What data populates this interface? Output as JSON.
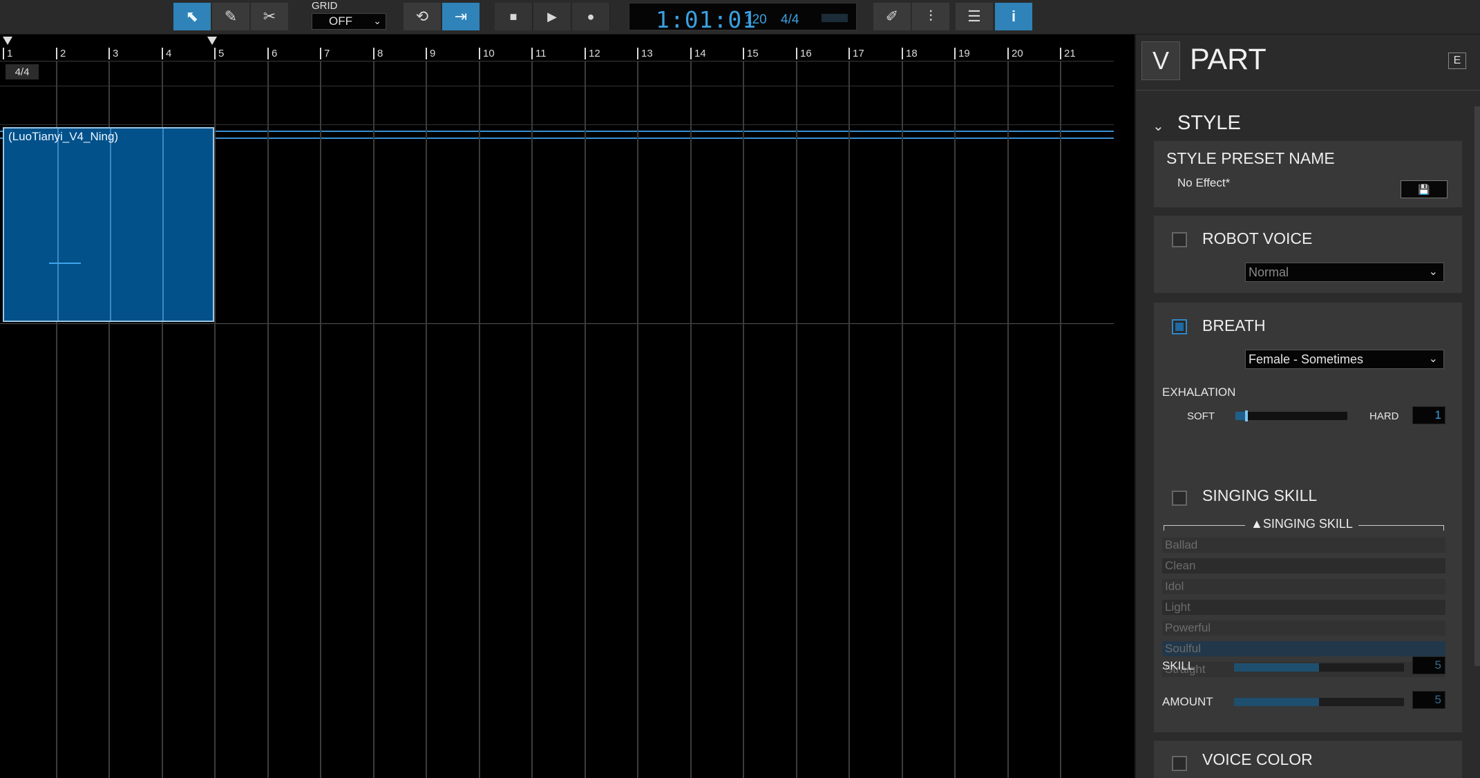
{
  "toolbar": {
    "tools": [
      {
        "name": "select-tool",
        "icon": "arrow-pointer-icon",
        "glyph": "⬉",
        "active": true
      },
      {
        "name": "pencil-tool",
        "icon": "pencil-icon",
        "glyph": "✎",
        "active": false
      },
      {
        "name": "scissors-tool",
        "icon": "scissors-icon",
        "glyph": "✂",
        "active": false
      }
    ],
    "grid_label": "GRID",
    "grid_value": "OFF",
    "loop_glyph": "⟲",
    "autoscroll_glyph": "⇥",
    "transport": {
      "stop_glyph": "■",
      "play_glyph": "▶",
      "record_glyph": "●"
    },
    "display": {
      "time": "1:01:01",
      "tempo": "120",
      "time_signature": "4/4"
    },
    "right_tools": [
      {
        "name": "edit-panel-button",
        "icon": "edit-icon",
        "glyph": "✐",
        "active": false
      },
      {
        "name": "mixer-button",
        "icon": "mixer-icon",
        "glyph": "⫶",
        "active": false
      },
      {
        "name": "list-button",
        "icon": "list-icon",
        "glyph": "☰",
        "active": false
      },
      {
        "name": "inspector-button",
        "icon": "info-icon",
        "glyph": "i",
        "active": true
      }
    ]
  },
  "arranger": {
    "bars": [
      "1",
      "2",
      "3",
      "4",
      "5",
      "6",
      "7",
      "8",
      "9",
      "10",
      "11",
      "12",
      "13",
      "14",
      "15",
      "16",
      "17",
      "18",
      "19",
      "20",
      "21"
    ],
    "time_signature": "4/4",
    "part": {
      "label": "(LuoTianyi_V4_Ning)"
    },
    "colors": {
      "part_fill": "#02518a",
      "accent": "#3aa0e0"
    }
  },
  "panel": {
    "logo": "V",
    "title": "PART",
    "menu_icon": "E",
    "section_title": "STYLE",
    "style_preset": {
      "label": "STYLE PRESET NAME",
      "value": "No Effect*"
    },
    "robot_voice": {
      "label": "ROBOT VOICE",
      "checked": false,
      "value": "Normal"
    },
    "breath": {
      "label": "BREATH",
      "checked": true,
      "value": "Female - Sometimes",
      "exhalation_label": "EXHALATION",
      "soft_label": "SOFT",
      "hard_label": "HARD",
      "exhalation_value": "1",
      "exhalation_level": 0.1
    },
    "singing_skill": {
      "label": "SINGING SKILL",
      "checked": false,
      "group_label": "SINGING SKILL",
      "items": [
        "Ballad",
        "Clean",
        "Idol",
        "Light",
        "Powerful",
        "Soulful",
        "Straight"
      ],
      "selected": "Soulful",
      "skill_label": "SKILL",
      "skill_value": "5",
      "skill_level": 0.5,
      "amount_label": "AMOUNT",
      "amount_value": "5",
      "amount_level": 0.5
    },
    "voice_color": {
      "label": "VOICE COLOR",
      "checked": false
    }
  }
}
